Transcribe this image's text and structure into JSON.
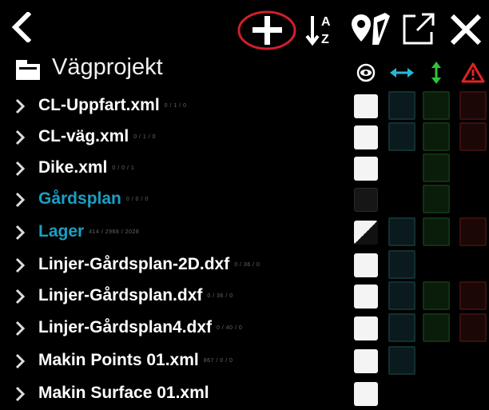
{
  "toolbar": {
    "back_icon": "chevron-left-icon",
    "add_icon": "plus-icon",
    "sort_icon": "sort-az-icon",
    "map_icon": "map-pin-icon",
    "export_icon": "external-link-icon",
    "close_icon": "close-icon",
    "sort_a": "A",
    "sort_z": "Z"
  },
  "header": {
    "title": "Vägprojekt",
    "columns": [
      {
        "icon": "eye-icon",
        "color": "#ffffff"
      },
      {
        "icon": "horizontal-arrows-icon",
        "color": "#27b6d6"
      },
      {
        "icon": "vertical-arrows-icon",
        "color": "#2fc43a"
      },
      {
        "icon": "warning-icon",
        "color": "#e02222"
      }
    ]
  },
  "colors": {
    "accent_blue": "#1aa0c4",
    "highlight_circle": "#d0202a"
  },
  "rows": [
    {
      "name": "CL-Uppfart.xml",
      "meta": "0 / 1 / 0",
      "color": "#ffffff",
      "visible": "on"
    },
    {
      "name": "CL-väg.xml",
      "meta": "0 / 1 / 0",
      "color": "#ffffff",
      "visible": "on"
    },
    {
      "name": "Dike.xml",
      "meta": "0 / 0 / 1",
      "color": "#ffffff",
      "visible": "on"
    },
    {
      "name": "Gårdsplan",
      "meta": "0 / 0 / 0",
      "color": "#1aa0c4",
      "visible": "off"
    },
    {
      "name": "Lager",
      "meta": "414 / 2968 / 2028",
      "color": "#1aa0c4",
      "visible": "half"
    },
    {
      "name": "Linjer-Gårdsplan-2D.dxf",
      "meta": "0 / 36 / 0",
      "color": "#ffffff",
      "visible": "on"
    },
    {
      "name": "Linjer-Gårdsplan.dxf",
      "meta": "0 / 36 / 0",
      "color": "#ffffff",
      "visible": "on"
    },
    {
      "name": "Linjer-Gårdsplan4.dxf",
      "meta": "0 / 40 / 0",
      "color": "#ffffff",
      "visible": "on"
    },
    {
      "name": "Makin Points 01.xml",
      "meta": "867 / 0 / 0",
      "color": "#ffffff",
      "visible": "on"
    },
    {
      "name": "Makin Surface 01.xml",
      "meta": "",
      "color": "#ffffff",
      "visible": "on"
    }
  ]
}
